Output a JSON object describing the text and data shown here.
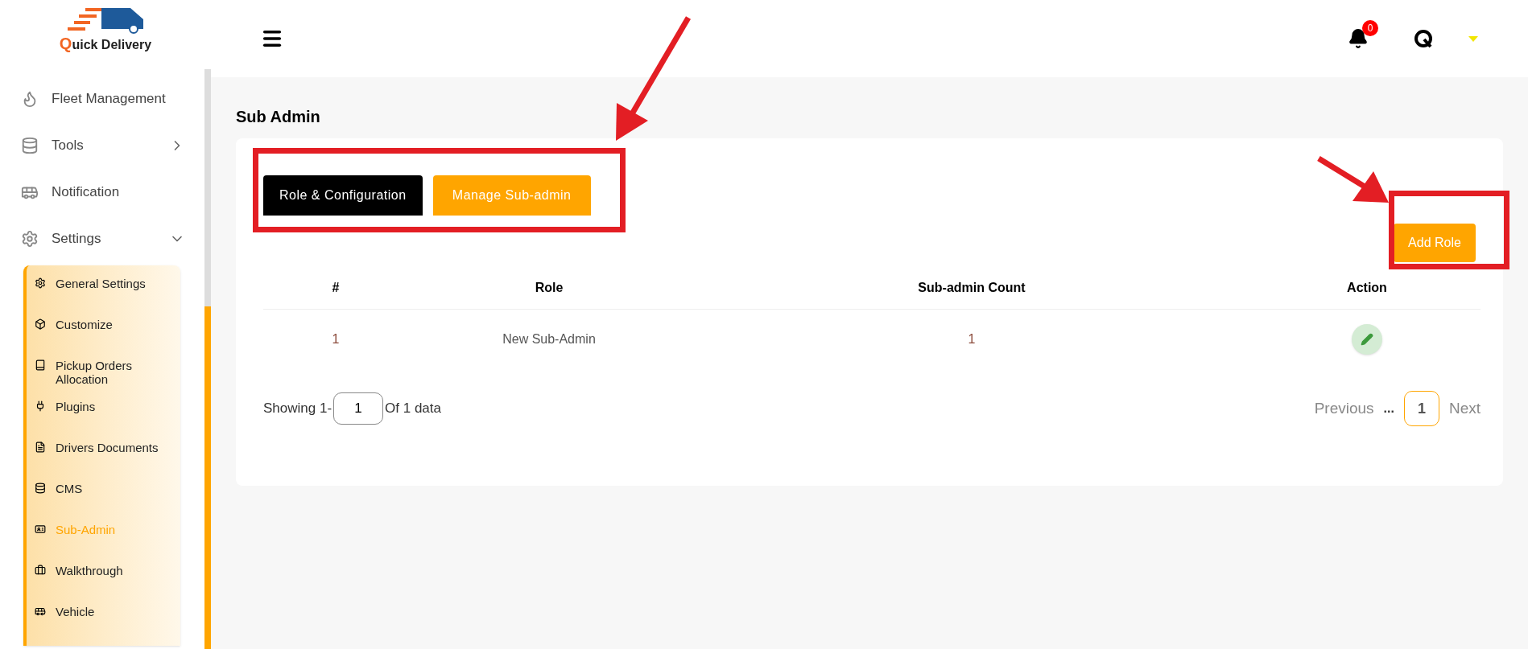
{
  "logo": {
    "initial": "Q",
    "rest": "uick Delivery"
  },
  "sidebar": {
    "items": [
      {
        "label": "Fleet Management",
        "selected": false
      },
      {
        "label": "Tools",
        "selected": false,
        "expanded": false
      },
      {
        "label": "Notification",
        "selected": false
      },
      {
        "label": "Settings",
        "selected": false,
        "expanded": true,
        "children": [
          {
            "label": "General Settings",
            "selected": false
          },
          {
            "label": "Customize",
            "selected": false
          },
          {
            "label": "Pickup Orders Allocation",
            "selected": false
          },
          {
            "label": "Plugins",
            "selected": false
          },
          {
            "label": "Drivers Documents",
            "selected": false
          },
          {
            "label": "CMS",
            "selected": false
          },
          {
            "label": "Sub-Admin",
            "selected": true
          },
          {
            "label": "Walkthrough",
            "selected": false
          },
          {
            "label": "Vehicle",
            "selected": false
          }
        ]
      }
    ]
  },
  "header": {
    "notification_count": "0"
  },
  "page": {
    "title": "Sub Admin",
    "tabs": [
      {
        "label": "Role & Configuration",
        "selected": true
      },
      {
        "label": "Manage Sub-admin",
        "selected": false
      }
    ],
    "add_button": "Add Role",
    "table": {
      "columns": [
        "#",
        "Role",
        "Sub-admin Count",
        "Action"
      ],
      "rows": [
        {
          "index": "1",
          "role": "New Sub-Admin",
          "count": "1"
        }
      ]
    },
    "pagination": {
      "showing": "Showing 1-",
      "page_value": "1",
      "of_text": "Of 1 data",
      "previous": "Previous",
      "ellipsis": "...",
      "pages": [
        {
          "label": "1",
          "selected": true
        }
      ],
      "next": "Next"
    }
  }
}
